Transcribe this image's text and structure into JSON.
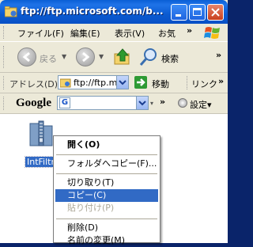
{
  "window": {
    "title": "ftp://ftp.microsoft.com/b..."
  },
  "menubar": {
    "items": [
      "ファイル(F)",
      "編集(E)",
      "表示(V)",
      "お気"
    ],
    "chevron": "»"
  },
  "toolbar": {
    "back_label": "戻る",
    "search_label": "検索",
    "chevron": "»"
  },
  "addressbar": {
    "label": "アドレス(D)",
    "value": "ftp://ftp.m",
    "go_label": "移動",
    "links_label": "リンク",
    "chevron": "»"
  },
  "googlebar": {
    "logo": "Google",
    "search_button_glyph": "G",
    "chevron": "»",
    "settings_label": "設定▾"
  },
  "content": {
    "file_name": "IntFiltr"
  },
  "context_menu": {
    "items": [
      {
        "label": "開く(O)",
        "state": "default"
      },
      {
        "label": "フォルダへコピー(F)...",
        "state": "normal"
      },
      {
        "label": "切り取り(T)",
        "state": "normal"
      },
      {
        "label": "コピー(C)",
        "state": "selected"
      },
      {
        "label": "貼り付け(P)",
        "state": "disabled"
      },
      {
        "label": "削除(D)",
        "state": "normal"
      },
      {
        "label": "名前の変更(M)",
        "state": "normal"
      }
    ]
  },
  "colors": {
    "titlebar": "#0b5bd1",
    "selection": "#316ac5",
    "close_button": "#c83f1d",
    "chrome": "#ece9d8"
  }
}
